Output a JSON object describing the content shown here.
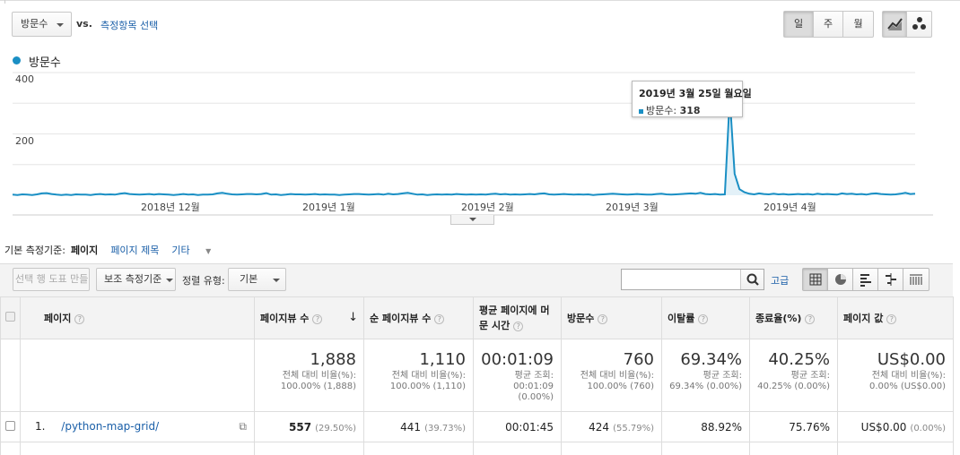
{
  "header": {
    "metric_select": "방문수",
    "vs_label": "vs.",
    "pick_metric_link": "측정항목 선택",
    "period_buttons": [
      "일",
      "주",
      "월"
    ],
    "period_selected": "일"
  },
  "chart_data": {
    "type": "line",
    "title": "",
    "legend": "방문수",
    "legend_color": "#1a8fc4",
    "y_ticks": [
      "400",
      "200"
    ],
    "ylim": [
      0,
      400
    ],
    "x_ticks": [
      "2018년 12월",
      "2019년 1월",
      "2019년 2월",
      "2019년 3월",
      "2019년 4월"
    ],
    "x_start": "2018-11-12",
    "x_end": "2019-04-28",
    "series": [
      {
        "name": "방문수",
        "values": [
          2,
          1,
          3,
          2,
          1,
          3,
          6,
          7,
          4,
          2,
          1,
          2,
          1,
          3,
          2,
          2,
          1,
          3,
          4,
          2,
          3,
          2,
          5,
          7,
          4,
          3,
          2,
          3,
          4,
          2,
          4,
          3,
          2,
          1,
          2,
          4,
          2,
          3,
          1,
          2,
          2,
          3,
          6,
          8,
          5,
          3,
          2,
          3,
          4,
          4,
          3,
          4,
          7,
          2,
          3,
          1,
          2,
          4,
          3,
          3,
          2,
          3,
          4,
          2,
          3,
          2,
          2,
          1,
          2,
          3,
          4,
          4,
          3,
          2,
          3,
          4,
          2,
          5,
          3,
          4,
          6,
          8,
          5,
          2,
          3,
          1,
          2,
          3,
          2,
          3,
          2,
          4,
          3,
          2,
          3,
          2,
          3,
          2,
          4,
          5,
          3,
          4,
          2,
          3,
          2,
          3,
          4,
          3,
          5,
          6,
          3,
          2,
          3,
          4,
          3,
          2,
          3,
          2,
          3,
          1,
          2,
          3,
          4,
          5,
          4,
          3,
          2,
          3,
          4,
          3,
          2,
          2,
          4,
          5,
          3,
          2,
          3,
          4,
          5,
          6,
          5,
          8,
          4,
          3,
          4,
          2,
          3,
          318,
          70,
          20,
          10,
          5,
          3,
          6,
          4,
          3,
          5,
          3,
          4,
          2,
          3,
          4,
          3,
          4,
          2,
          5,
          3,
          4,
          3,
          2,
          6,
          4,
          5,
          3,
          4,
          2,
          5,
          6,
          4,
          3,
          2,
          3,
          5,
          8,
          4,
          5
        ]
      }
    ],
    "tooltip": {
      "date": "2019년 3월 25일 월요일",
      "label": "방문수:",
      "value": "318"
    }
  },
  "dimension_bar": {
    "label": "기본 측정기준:",
    "selected": "페이지",
    "options": [
      "페이지 제목",
      "기타"
    ]
  },
  "toolbar": {
    "make_chart_button": "선택 행 도표 만들기",
    "secondary_dim_button": "보조 측정기준",
    "sort_label": "정렬 유형:",
    "sort_value": "기본",
    "search_placeholder": "",
    "advanced_link": "고급"
  },
  "table": {
    "columns": [
      "페이지",
      "페이지뷰 수",
      "순 페이지뷰 수",
      "평균 페이지에 머문 시간",
      "방문수",
      "이탈률",
      "종료율(%)",
      "페이지 값"
    ],
    "totals": [
      {
        "big": "1,888",
        "sub": "전체 대비 비율(%): 100.00% (1,888)"
      },
      {
        "big": "1,110",
        "sub": "전체 대비 비율(%): 100.00% (1,110)"
      },
      {
        "big": "00:01:09",
        "sub": "평균 조회: 00:01:09 (0.00%)"
      },
      {
        "big": "760",
        "sub": "전체 대비 비율(%): 100.00% (760)"
      },
      {
        "big": "69.34%",
        "sub": "평균 조회: 69.34% (0.00%)"
      },
      {
        "big": "40.25%",
        "sub": "평균 조회: 40.25% (0.00%)"
      },
      {
        "big": "US$0.00",
        "sub": "전체 대비 비율(%): 0.00% (US$0.00)"
      }
    ],
    "rows": [
      {
        "index": "1.",
        "page": "/python-map-grid/",
        "pageviews": "557",
        "pageviews_pct": "(29.50%)",
        "unique": "441",
        "unique_pct": "(39.73%)",
        "avg_time": "00:01:45",
        "sessions": "424",
        "sessions_pct": "(55.79%)",
        "bounce": "88.92%",
        "exit": "75.76%",
        "value": "US$0.00",
        "value_pct": "(0.00%)"
      }
    ]
  }
}
